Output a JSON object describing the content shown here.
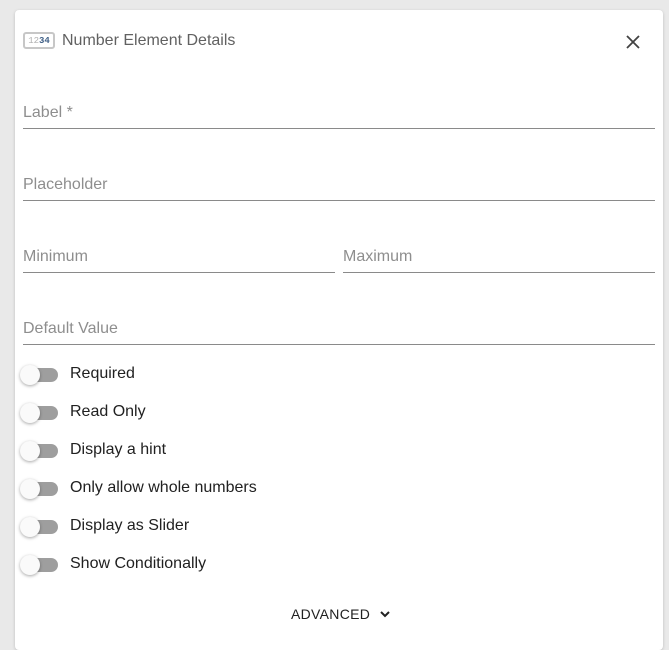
{
  "dialog": {
    "icon_digits_light": "12",
    "icon_digits_dark": "34",
    "title": "Number Element Details",
    "close_icon": "close-icon"
  },
  "fields": {
    "label": {
      "placeholder": "Label *",
      "value": ""
    },
    "placeholder": {
      "placeholder": "Placeholder",
      "value": ""
    },
    "minimum": {
      "placeholder": "Minimum",
      "value": ""
    },
    "maximum": {
      "placeholder": "Maximum",
      "value": ""
    },
    "default_value": {
      "placeholder": "Default Value",
      "value": ""
    }
  },
  "toggles": [
    {
      "label": "Required",
      "on": false
    },
    {
      "label": "Read Only",
      "on": false
    },
    {
      "label": "Display a hint",
      "on": false
    },
    {
      "label": "Only allow whole numbers",
      "on": false
    },
    {
      "label": "Display as Slider",
      "on": false
    },
    {
      "label": "Show Conditionally",
      "on": false
    }
  ],
  "advanced": {
    "label": "ADVANCED",
    "icon": "chevron-down-icon"
  },
  "colors": {
    "background": "#e9e9e9",
    "panel": "#ffffff",
    "toggle_track_off": "#9e9e9e",
    "toggle_thumb": "#fafafa",
    "underline": "#8a8a8a",
    "placeholder_text": "#8e8e8e"
  }
}
